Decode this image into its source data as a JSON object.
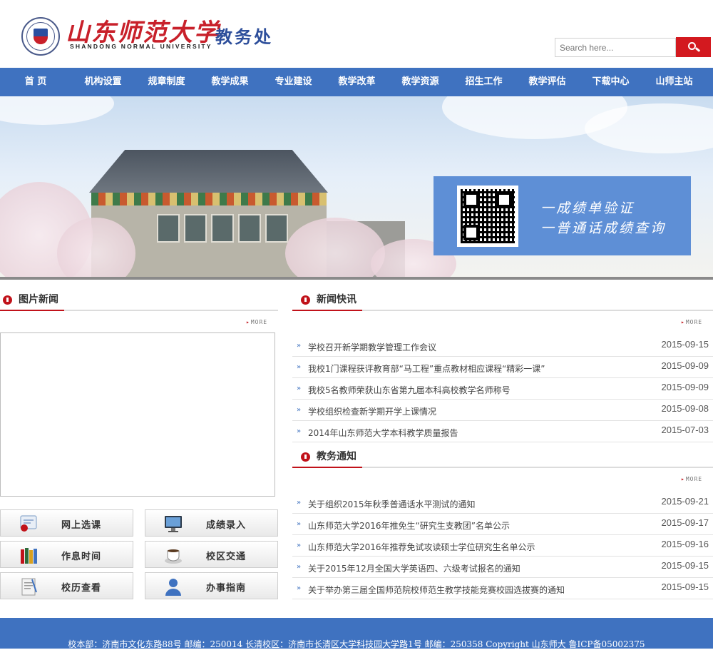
{
  "header": {
    "logo_cn": "山东师范大学",
    "logo_en": "SHANDONG NORMAL UNIVERSITY",
    "office": "教务处",
    "search_placeholder": "Search here...",
    "search_icon": "search-icon"
  },
  "nav": [
    "首 页",
    "机构设置",
    "规章制度",
    "教学成果",
    "专业建设",
    "教学改革",
    "教学资源",
    "招生工作",
    "教学评估",
    "下载中心",
    "山师主站"
  ],
  "banner": {
    "qr_line1": "一成绩单验证",
    "qr_line2": "一普通话成绩查询"
  },
  "photo_news": {
    "title": "图片新闻",
    "more": "MORE"
  },
  "quick_links": [
    {
      "label": "网上选课",
      "icon": "certificate-icon"
    },
    {
      "label": "成绩录入",
      "icon": "monitor-icon"
    },
    {
      "label": "作息时间",
      "icon": "books-icon"
    },
    {
      "label": "校区交通",
      "icon": "coffee-cup-icon"
    },
    {
      "label": "校历查看",
      "icon": "notepad-icon"
    },
    {
      "label": "办事指南",
      "icon": "user-icon"
    }
  ],
  "news_flash": {
    "title": "新闻快讯",
    "more": "MORE",
    "items": [
      {
        "title": "学校召开新学期教学管理工作会议",
        "date": "2015-09-15"
      },
      {
        "title": "我校1门课程获评教育部“马工程”重点教材相应课程“精彩一课”",
        "date": "2015-09-09"
      },
      {
        "title": "我校5名教师荣获山东省第九届本科高校教学名师称号",
        "date": "2015-09-09"
      },
      {
        "title": "学校组织检查新学期开学上课情况",
        "date": "2015-09-08"
      },
      {
        "title": "2014年山东师范大学本科教学质量报告",
        "date": "2015-07-03"
      }
    ]
  },
  "notices": {
    "title": "教务通知",
    "more": "MORE",
    "items": [
      {
        "title": "关于组织2015年秋季普通话水平测试的通知",
        "date": "2015-09-21"
      },
      {
        "title": "山东师范大学2016年推免生“研究生支教团”名单公示",
        "date": "2015-09-17"
      },
      {
        "title": "山东师范大学2016年推荐免试攻读硕士学位研究生名单公示",
        "date": "2015-09-16"
      },
      {
        "title": "关于2015年12月全国大学英语四、六级考试报名的通知",
        "date": "2015-09-15"
      },
      {
        "title": "关于举办第三届全国师范院校师范生教学技能竞赛校园选拔赛的通知",
        "date": "2015-09-15"
      }
    ]
  },
  "footer": {
    "text": "校本部：济南市文化东路88号  邮编：250014 长清校区：济南市长清区大学科技园大学路1号  邮编：250358 Copyright 山东师大  鲁ICP备05002375"
  },
  "colors": {
    "nav_bg": "#3f72c0",
    "accent_red": "#c1121a",
    "qr_panel": "#5e8fd6"
  }
}
